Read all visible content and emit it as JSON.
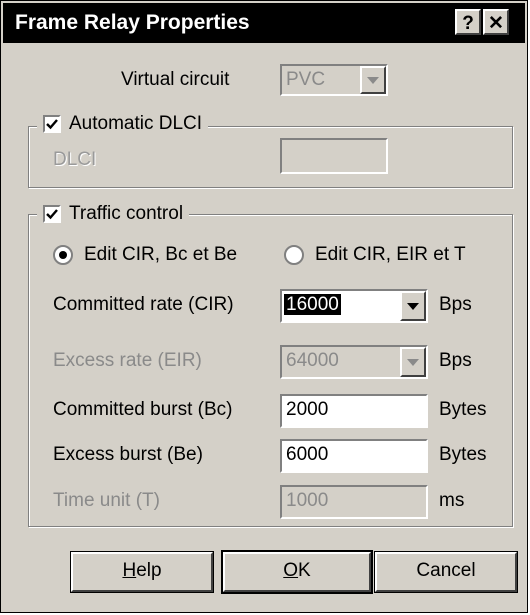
{
  "window": {
    "title": "Frame Relay Properties",
    "help_glyph": "?",
    "close_glyph": "✕"
  },
  "virtual_circuit": {
    "label": "Virtual circuit",
    "value": "PVC"
  },
  "dlci_group": {
    "checkbox_label": "Automatic DLCI",
    "checked": true,
    "dlci_label": "DLCI",
    "dlci_value": ""
  },
  "traffic": {
    "checkbox_label": "Traffic control",
    "checked": true,
    "radio1_label": "Edit CIR, Bc et Be",
    "radio2_label": "Edit CIR, EIR et T",
    "selected_radio": 1,
    "rows": {
      "cir_label": "Committed rate (CIR)",
      "cir_value": "16000",
      "cir_unit": "Bps",
      "eir_label": "Excess rate (EIR)",
      "eir_value": "64000",
      "eir_unit": "Bps",
      "bc_label": "Committed burst (Bc)",
      "bc_value": "2000",
      "bc_unit": "Bytes",
      "be_label": "Excess burst (Be)",
      "be_value": "6000",
      "be_unit": "Bytes",
      "t_label": "Time unit (T)",
      "t_value": "1000",
      "t_unit": "ms"
    }
  },
  "buttons": {
    "help_prefix": "H",
    "help_rest": "elp",
    "ok_prefix": "O",
    "ok_rest": "K",
    "cancel": "Cancel"
  }
}
